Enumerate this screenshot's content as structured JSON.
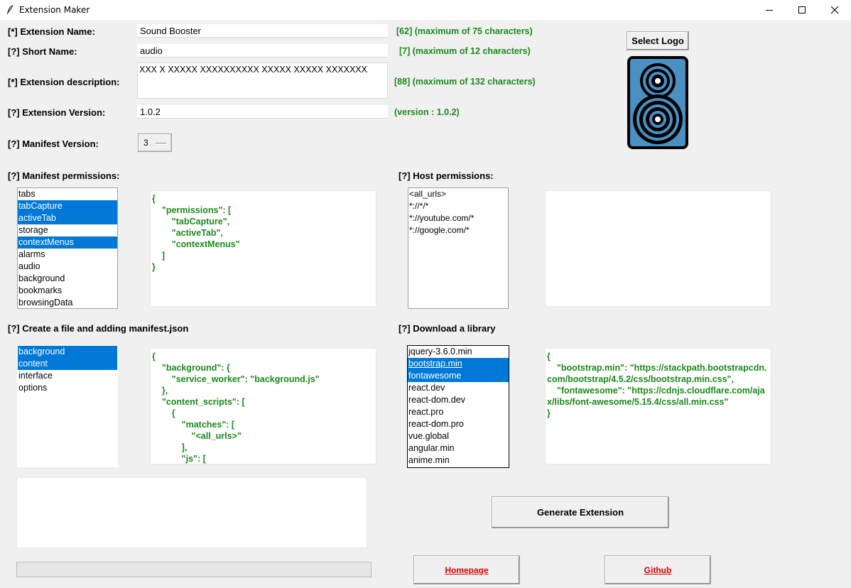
{
  "window": {
    "title": "Extension Maker"
  },
  "colors": {
    "accent_green": "#1b8a1b",
    "selection_blue": "#0078d7",
    "link_red": "#e00000",
    "speaker_blue": "#4a90c2"
  },
  "icons": {
    "app": "feather-icon",
    "logo": "speaker-icon"
  },
  "form": {
    "name_label": "[*] Extension Name:",
    "name_value": "Sound Booster",
    "name_hint": "[62] (maximum of 75 characters)",
    "short_label": "[?] Short Name:",
    "short_value": "audio",
    "short_hint": "[7] (maximum of 12 characters)",
    "desc_label": "[*] Extension description:",
    "desc_value": "XXX X XXXXX XXXXXXXXXX XXXXX XXXXX XXXXXXX",
    "desc_hint": "[88] (maximum of 132 characters)",
    "version_label": "[?] Extension Version:",
    "version_value": "1.0.2",
    "version_hint": "(version : 1.0.2)",
    "manifest_label": "[?] Manifest Version:",
    "manifest_value": "3",
    "select_logo": "Select Logo"
  },
  "manifest_permissions": {
    "label": "[?] Manifest permissions:",
    "items": [
      {
        "label": "tabs",
        "selected": false
      },
      {
        "label": "tabCapture",
        "selected": true
      },
      {
        "label": "activeTab",
        "selected": true
      },
      {
        "label": "storage",
        "selected": false
      },
      {
        "label": "contextMenus",
        "selected": true
      },
      {
        "label": "alarms",
        "selected": false
      },
      {
        "label": "audio",
        "selected": false
      },
      {
        "label": "background",
        "selected": false
      },
      {
        "label": "bookmarks",
        "selected": false
      },
      {
        "label": "browsingData",
        "selected": false
      }
    ],
    "json": "{\n    \"permissions\": [\n        \"tabCapture\",\n        \"activeTab\",\n        \"contextMenus\"\n    ]\n}"
  },
  "host_permissions": {
    "label": "[?] Host permissions:",
    "items": [
      {
        "label": "<all_urls>",
        "selected": false
      },
      {
        "label": "*://*/*",
        "selected": false
      },
      {
        "label": "*://youtube.com/*",
        "selected": false
      },
      {
        "label": "*://google.com/*",
        "selected": false
      }
    ],
    "json": ""
  },
  "files": {
    "label": "[?] Create a file and adding manifest.json",
    "items": [
      {
        "label": "background",
        "selected": true
      },
      {
        "label": "content",
        "selected": true
      },
      {
        "label": "interface",
        "selected": false
      },
      {
        "label": "options",
        "selected": false
      }
    ],
    "json": "{\n    \"background\": {\n        \"service_worker\": \"background.js\"\n    },\n    \"content_scripts\": [\n        {\n            \"matches\": [\n                \"<all_urls>\"\n            ],\n            \"js\": ["
  },
  "libraries": {
    "label": "[?] Download a library",
    "items": [
      {
        "label": "jquery-3.6.0.min",
        "selected": false
      },
      {
        "label": "bootstrap.min",
        "selected": true,
        "active": true
      },
      {
        "label": "fontawesome",
        "selected": true
      },
      {
        "label": "react.dev",
        "selected": false
      },
      {
        "label": "react-dom.dev",
        "selected": false
      },
      {
        "label": "react.pro",
        "selected": false
      },
      {
        "label": "react-dom.pro",
        "selected": false
      },
      {
        "label": "vue.global",
        "selected": false
      },
      {
        "label": "angular.min",
        "selected": false
      },
      {
        "label": "anime.min",
        "selected": false
      }
    ],
    "json": "{\n    \"bootstrap.min\": \"https://stackpath.bootstrapcdn.com/bootstrap/4.5.2/css/bootstrap.min.css\",\n    \"fontawesome\": \"https://cdnjs.cloudflare.com/ajax/libs/font-awesome/5.15.4/css/all.min.css\"\n}"
  },
  "log": {
    "text": ""
  },
  "progress": {
    "value": 0
  },
  "actions": {
    "generate": "Generate Extension",
    "homepage": "Homepage",
    "github": "Github"
  }
}
